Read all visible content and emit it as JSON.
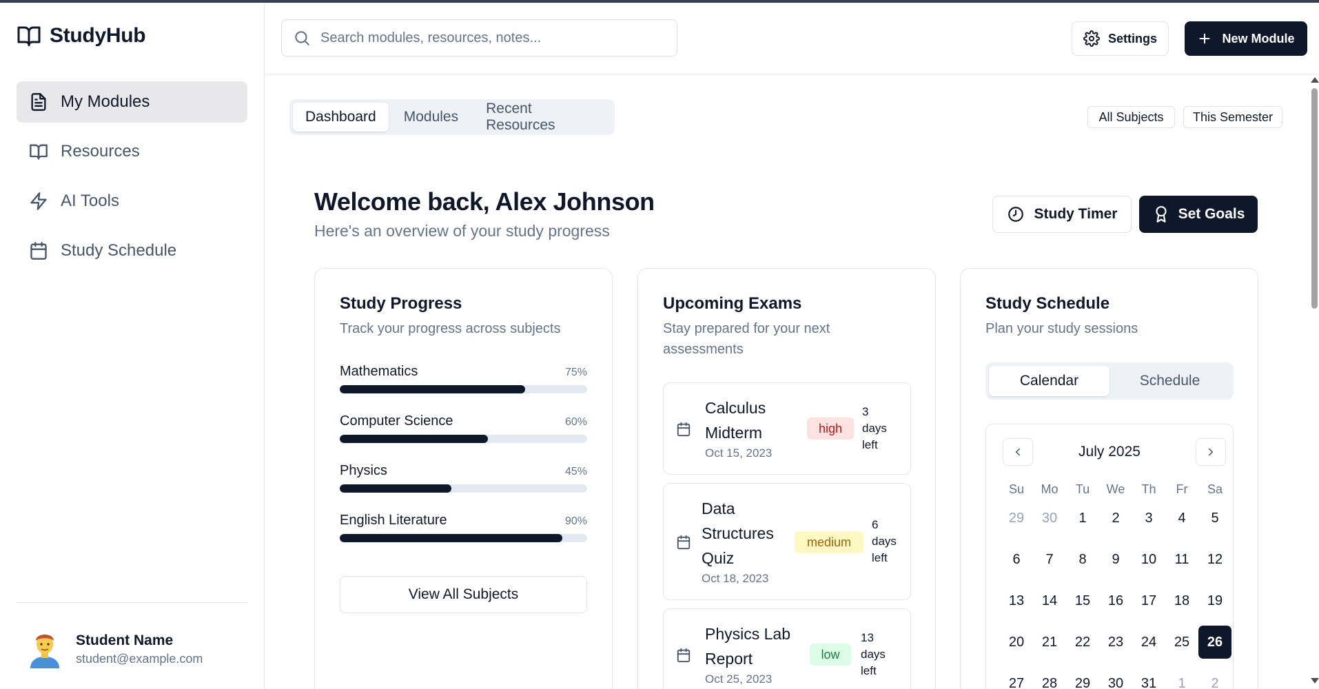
{
  "brand": {
    "name": "StudyHub",
    "icon": "book-open-icon"
  },
  "sidebar": {
    "items": [
      {
        "label": "My Modules",
        "icon": "file-text-icon",
        "active": true
      },
      {
        "label": "Resources",
        "icon": "book-open-icon",
        "active": false
      },
      {
        "label": "AI Tools",
        "icon": "zap-icon",
        "active": false
      },
      {
        "label": "Study Schedule",
        "icon": "calendar-icon",
        "active": false
      }
    ],
    "user": {
      "name": "Student Name",
      "email": "student@example.com"
    }
  },
  "header": {
    "search_placeholder": "Search modules, resources, notes...",
    "settings_label": "Settings",
    "new_module_label": "New Module"
  },
  "tabs": [
    {
      "label": "Dashboard",
      "active": true
    },
    {
      "label": "Modules",
      "active": false
    },
    {
      "label": "Recent Resources",
      "active": false
    }
  ],
  "filters": {
    "subjects": "All Subjects",
    "period": "This Semester"
  },
  "welcome": {
    "title": "Welcome back, Alex Johnson",
    "subtitle": "Here's an overview of your study progress",
    "study_timer_label": "Study Timer",
    "set_goals_label": "Set Goals"
  },
  "progress_card": {
    "title": "Study Progress",
    "subtitle": "Track your progress across subjects",
    "subjects": [
      {
        "name": "Mathematics",
        "percent_label": "75%",
        "percent": 75
      },
      {
        "name": "Computer Science",
        "percent_label": "60%",
        "percent": 60
      },
      {
        "name": "Physics",
        "percent_label": "45%",
        "percent": 45
      },
      {
        "name": "English Literature",
        "percent_label": "90%",
        "percent": 90
      }
    ],
    "view_all_label": "View All Subjects"
  },
  "exams_card": {
    "title": "Upcoming Exams",
    "subtitle": "Stay prepared for your next assessments",
    "exams": [
      {
        "name_lines": [
          "Calculus",
          "Midterm"
        ],
        "date": "Oct 15, 2023",
        "priority": "high",
        "days_lines": [
          "3",
          "days",
          "left"
        ]
      },
      {
        "name_lines": [
          "Data",
          "Structures",
          "Quiz"
        ],
        "date": "Oct 18, 2023",
        "priority": "medium",
        "days_lines": [
          "6",
          "days",
          "left"
        ]
      },
      {
        "name_lines": [
          "Physics Lab",
          "Report"
        ],
        "date": "Oct 25, 2023",
        "priority": "low",
        "days_lines": [
          "13",
          "days",
          "left"
        ]
      }
    ]
  },
  "schedule_card": {
    "title": "Study Schedule",
    "subtitle": "Plan your study sessions",
    "segments": [
      {
        "label": "Calendar",
        "active": true
      },
      {
        "label": "Schedule",
        "active": false
      }
    ],
    "calendar": {
      "month": "July 2025",
      "weekdays": [
        "Su",
        "Mo",
        "Tu",
        "We",
        "Th",
        "Fr",
        "Sa"
      ],
      "days": [
        {
          "d": "29",
          "muted": true
        },
        {
          "d": "30",
          "muted": true
        },
        {
          "d": "1"
        },
        {
          "d": "2"
        },
        {
          "d": "3"
        },
        {
          "d": "4"
        },
        {
          "d": "5"
        },
        {
          "d": "6"
        },
        {
          "d": "7"
        },
        {
          "d": "8"
        },
        {
          "d": "9"
        },
        {
          "d": "10"
        },
        {
          "d": "11"
        },
        {
          "d": "12"
        },
        {
          "d": "13"
        },
        {
          "d": "14"
        },
        {
          "d": "15"
        },
        {
          "d": "16"
        },
        {
          "d": "17"
        },
        {
          "d": "18"
        },
        {
          "d": "19"
        },
        {
          "d": "20"
        },
        {
          "d": "21"
        },
        {
          "d": "22"
        },
        {
          "d": "23"
        },
        {
          "d": "24"
        },
        {
          "d": "25"
        },
        {
          "d": "26",
          "selected": true
        },
        {
          "d": "27"
        },
        {
          "d": "28"
        },
        {
          "d": "29"
        },
        {
          "d": "30"
        },
        {
          "d": "31"
        },
        {
          "d": "1",
          "muted": true
        },
        {
          "d": "2",
          "muted": true
        }
      ]
    }
  },
  "colors": {
    "primary": "#0f172a",
    "muted_text": "#64748b",
    "badge_high_bg": "#fee2e2",
    "badge_high_text": "#b91c1c",
    "badge_medium_bg": "#fef9c3",
    "badge_medium_text": "#a16207",
    "badge_low_bg": "#dcfce7",
    "badge_low_text": "#15803d"
  }
}
